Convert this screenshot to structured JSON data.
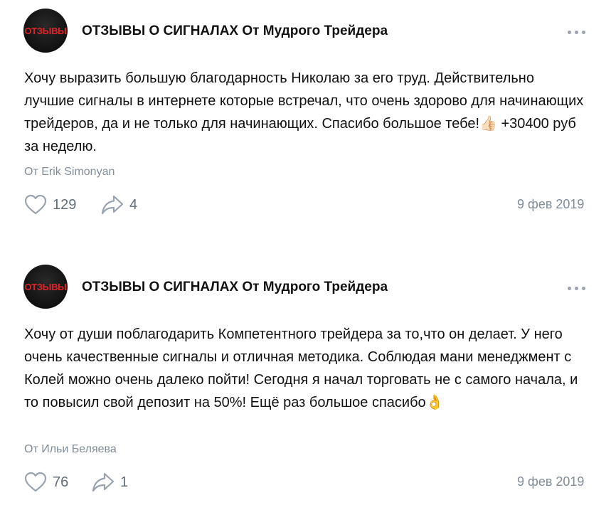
{
  "posts": [
    {
      "avatar_text": "ОТЗЫВЫ",
      "group_name": "ОТЗЫВЫ О СИГНАЛАХ От Мудрого Трейдера",
      "text": "Хочу выразить большую благодарность Николаю за его труд. Действительно лучшие сигналы в интернете которые встречал, что очень здорово для начинающих трейдеров, да и не только для начинающих. Спасибо большое тебе!👍🏻 +30400 руб за неделю.",
      "author": "От Erik Simonyan",
      "likes": "129",
      "shares": "4",
      "date": "9 фев 2019",
      "icons": {
        "like": "heart-icon",
        "share": "share-arrow-icon",
        "more": "more-dots-icon"
      }
    },
    {
      "avatar_text": "ОТЗЫВЫ",
      "group_name": "ОТЗЫВЫ О СИГНАЛАХ От Мудрого Трейдера",
      "text": "Хочу от души поблагодарить Компетентного трейдера за то,что он делает. У него очень качественные сигналы и отличная методика. Соблюдая мани менеджмент с Колей можно очень далеко пойти! Сегодня я начал торговать не с самого начала, и то повысил свой депозит на 50%! Ещё раз большое спасибо👌",
      "author": "От Ильи Беляева",
      "likes": "76",
      "shares": "1",
      "date": "9 фев 2019",
      "icons": {
        "like": "heart-icon",
        "share": "share-arrow-icon",
        "more": "more-dots-icon"
      }
    }
  ],
  "colors": {
    "secondary_text": "#818c99",
    "icon": "#99a2ad",
    "brand_red": "#e0222a"
  }
}
